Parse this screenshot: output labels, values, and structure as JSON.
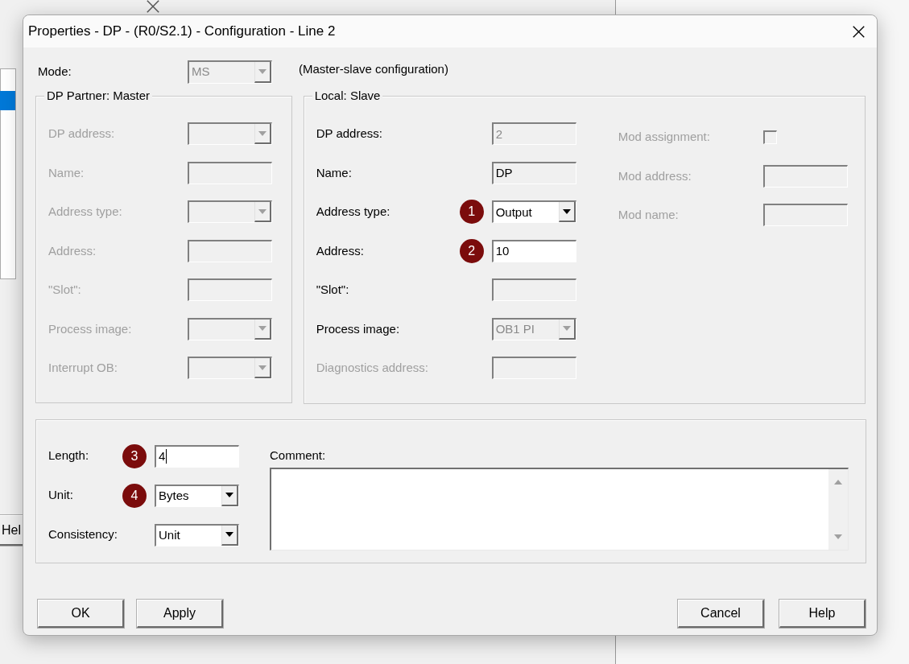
{
  "background_window": {
    "button_label": "Hel"
  },
  "dialog": {
    "title": "Properties - DP - (R0/S2.1) - Configuration - Line 2",
    "mode": {
      "label": "Mode:",
      "value": "MS",
      "disabled": true
    },
    "mode_note": "(Master-slave configuration)",
    "master": {
      "title": "DP Partner: Master",
      "fields": [
        {
          "kind": "combo",
          "label": "DP address:",
          "disabled": true,
          "label_disabled": true
        },
        {
          "kind": "text",
          "label": "Name:",
          "disabled": true,
          "label_disabled": true
        },
        {
          "kind": "combo",
          "label": "Address type:",
          "disabled": true,
          "label_disabled": true
        },
        {
          "kind": "text",
          "label": "Address:",
          "disabled": true,
          "label_disabled": true
        },
        {
          "kind": "text",
          "label": "\"Slot\":",
          "disabled": true,
          "label_disabled": true
        },
        {
          "kind": "combo",
          "label": "Process image:",
          "disabled": true,
          "label_disabled": true
        },
        {
          "kind": "combo",
          "label": "Interrupt OB:",
          "disabled": true,
          "label_disabled": true
        }
      ]
    },
    "slave": {
      "title": "Local: Slave",
      "fields": [
        {
          "kind": "text",
          "label": "DP address:",
          "value": "2",
          "disabled": true,
          "label_disabled": false
        },
        {
          "kind": "text",
          "label": "Name:",
          "value": "DP",
          "disabled": false,
          "read_only": true,
          "label_disabled": false
        },
        {
          "kind": "combo",
          "label": "Address type:",
          "value": "Output",
          "disabled": false,
          "label_disabled": false,
          "marker": "1"
        },
        {
          "kind": "text",
          "label": "Address:",
          "value": "10",
          "disabled": false,
          "label_disabled": false,
          "marker": "2"
        },
        {
          "kind": "text",
          "label": "\"Slot\":",
          "disabled": true,
          "label_disabled": false
        },
        {
          "kind": "combo",
          "label": "Process image:",
          "value": "OB1 PI",
          "disabled": true,
          "label_disabled": false
        },
        {
          "kind": "text",
          "label": "Diagnostics address:",
          "disabled": true,
          "label_disabled": true
        }
      ],
      "mod_fields": [
        {
          "kind": "checkbox",
          "label": "Mod assignment:",
          "checked": false,
          "disabled": true,
          "label_disabled": true
        },
        {
          "kind": "text",
          "label": "Mod address:",
          "disabled": true,
          "label_disabled": true
        },
        {
          "kind": "text",
          "label": "Mod name:",
          "disabled": true,
          "label_disabled": true
        }
      ]
    },
    "data_fields": [
      {
        "kind": "text",
        "label": "Length:",
        "value": "4",
        "disabled": false,
        "label_disabled": false,
        "marker": "3",
        "focused": true
      },
      {
        "kind": "combo",
        "label": "Unit:",
        "value": "Bytes",
        "disabled": false,
        "label_disabled": false,
        "marker": "4"
      },
      {
        "kind": "combo",
        "label": "Consistency:",
        "value": "Unit",
        "disabled": false,
        "label_disabled": false
      }
    ],
    "comment": {
      "label": "Comment:"
    },
    "buttons_left": [
      "OK",
      "Apply"
    ],
    "buttons_right": [
      "Cancel",
      "Help"
    ]
  }
}
